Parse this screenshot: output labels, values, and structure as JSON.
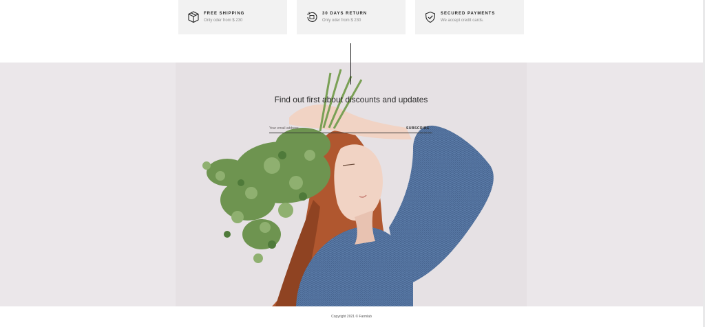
{
  "features": [
    {
      "icon": "box-icon",
      "title": "FREE SHIPPING",
      "subtitle": "Only oder from $ 230"
    },
    {
      "icon": "return-icon",
      "title": "30 DAYS RETURN",
      "subtitle": "Only oder from $ 230"
    },
    {
      "icon": "shield-check-icon",
      "title": "SECURED PAYMENTS",
      "subtitle": "We accept credit cards."
    }
  ],
  "newsletter": {
    "headline": "Find out first about discounts and updates",
    "email_placeholder": "Your email address",
    "subscribe_label": "SUBSCRIBE"
  },
  "footer": {
    "copyright": "Copyright 2021 © Farmlab"
  },
  "colors": {
    "feature_bg": "#f2f2f2",
    "newsletter_bg": "#ebe7ea",
    "sweater": "#5b7ba8",
    "hair": "#b0572f",
    "greens": "#6e9450"
  }
}
